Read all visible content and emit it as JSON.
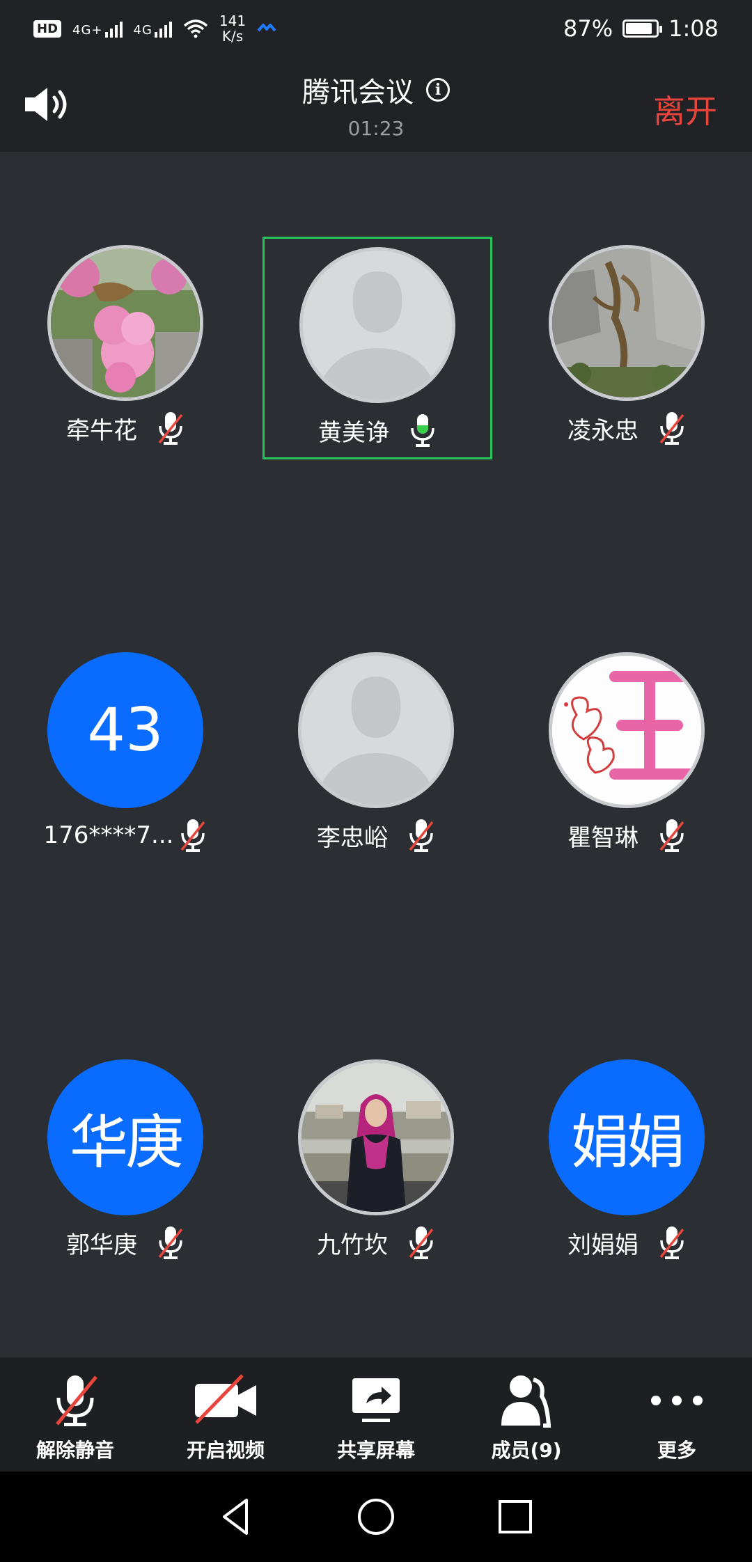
{
  "status_bar": {
    "hd": "HD",
    "sim1": "4G+",
    "sim2": "4G",
    "net_speed_value": "141",
    "net_speed_unit": "K/s",
    "battery": "87%",
    "time": "1:08"
  },
  "header": {
    "title": "腾讯会议",
    "timer": "01:23",
    "leave_label": "离开"
  },
  "participants": [
    {
      "name": "牵牛花",
      "avatar": "photo-flowers",
      "mic": "muted",
      "speaking": false
    },
    {
      "name": "黄美诤",
      "avatar": "default",
      "mic": "active",
      "speaking": true
    },
    {
      "name": "凌永忠",
      "avatar": "photo-rock",
      "mic": "muted",
      "speaking": false
    },
    {
      "name": "176****7...",
      "avatar_text": "43",
      "mic": "muted",
      "speaking": false
    },
    {
      "name": "李忠峪",
      "avatar": "default",
      "mic": "muted",
      "speaking": false
    },
    {
      "name": "瞿智琳",
      "avatar": "photo-drawing",
      "mic": "muted",
      "speaking": false
    },
    {
      "name": "郭华庚",
      "avatar_text": "华庚",
      "mic": "muted",
      "speaking": false
    },
    {
      "name": "九竹坎",
      "avatar": "photo-person",
      "mic": "muted",
      "speaking": false
    },
    {
      "name": "刘娟娟",
      "avatar_text": "娟娟",
      "mic": "muted",
      "speaking": false
    }
  ],
  "toolbar": {
    "unmute_label": "解除静音",
    "video_label": "开启视频",
    "share_label": "共享屏幕",
    "members_label": "成员(9)",
    "more_label": "更多"
  },
  "colors": {
    "background": "#2b2e33",
    "header": "#202225",
    "leave": "#e8453c",
    "active_border": "#28c35a",
    "avatar_blue": "#0a6cff",
    "mic_active": "#3ccf4e",
    "mute_slash": "#e8453c"
  }
}
